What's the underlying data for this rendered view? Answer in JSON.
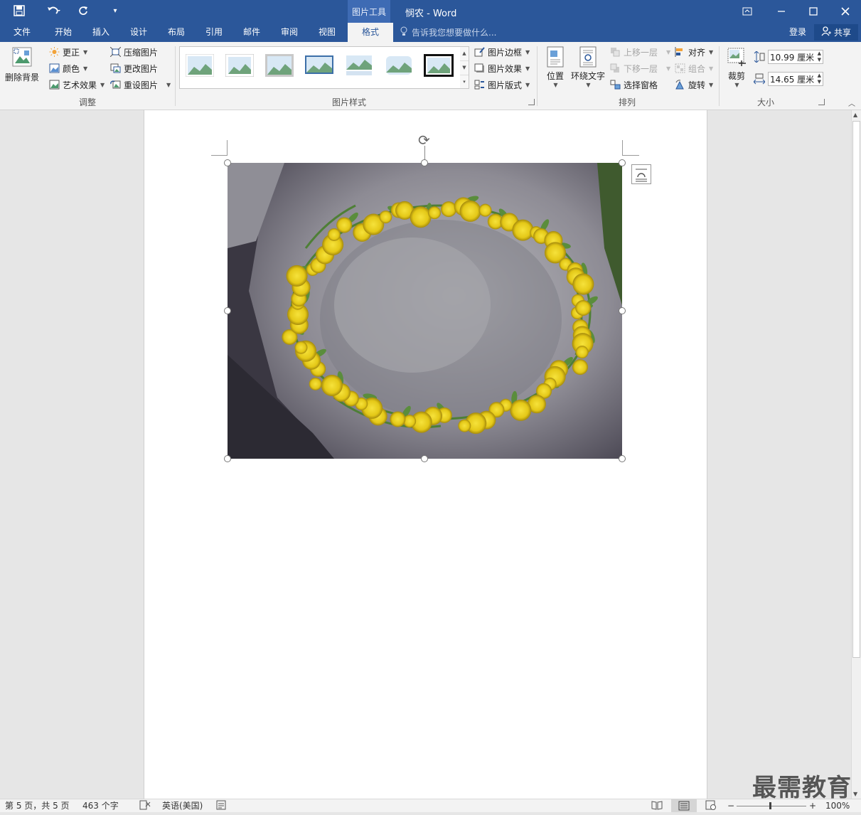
{
  "window": {
    "title": "悯农 - Word",
    "contextual_tab_group": "图片工具"
  },
  "quick_access": {
    "save_icon": "save-icon",
    "undo_icon": "undo-icon",
    "redo_icon": "redo-icon",
    "customize_icon": "customize-qat-icon"
  },
  "tabs": [
    {
      "label": "文件"
    },
    {
      "label": "开始"
    },
    {
      "label": "插入"
    },
    {
      "label": "设计"
    },
    {
      "label": "布局"
    },
    {
      "label": "引用"
    },
    {
      "label": "邮件"
    },
    {
      "label": "审阅"
    },
    {
      "label": "视图"
    },
    {
      "label": "格式",
      "active": true
    }
  ],
  "tell_me": "告诉我您想要做什么...",
  "account": {
    "login": "登录",
    "share": "共享"
  },
  "ribbon": {
    "adjust": {
      "label": "调整",
      "remove_bg": "删除背景",
      "corrections": "更正",
      "color": "颜色",
      "artistic": "艺术效果",
      "compress": "压缩图片",
      "change": "更改图片",
      "reset": "重设图片"
    },
    "styles": {
      "label": "图片样式",
      "border": "图片边框",
      "effects": "图片效果",
      "layout": "图片版式"
    },
    "arrange": {
      "label": "排列",
      "position": "位置",
      "wrap": "环绕文字",
      "forward": "上移一层",
      "backward": "下移一层",
      "selection": "选择窗格",
      "align": "对齐",
      "group": "组合",
      "rotate": "旋转"
    },
    "size": {
      "label": "大小",
      "crop": "裁剪",
      "height": "10.99 厘米",
      "width": "14.65 厘米"
    }
  },
  "status": {
    "page": "第 5 页，共 5 页",
    "words": "463 个字",
    "language": "英语(美国)",
    "zoom": "100%"
  },
  "watermark": "最需教育",
  "colors": {
    "accent": "#2b579a",
    "ribbon_bg": "#f3f3f3",
    "workspace": "#e6e6e6"
  }
}
